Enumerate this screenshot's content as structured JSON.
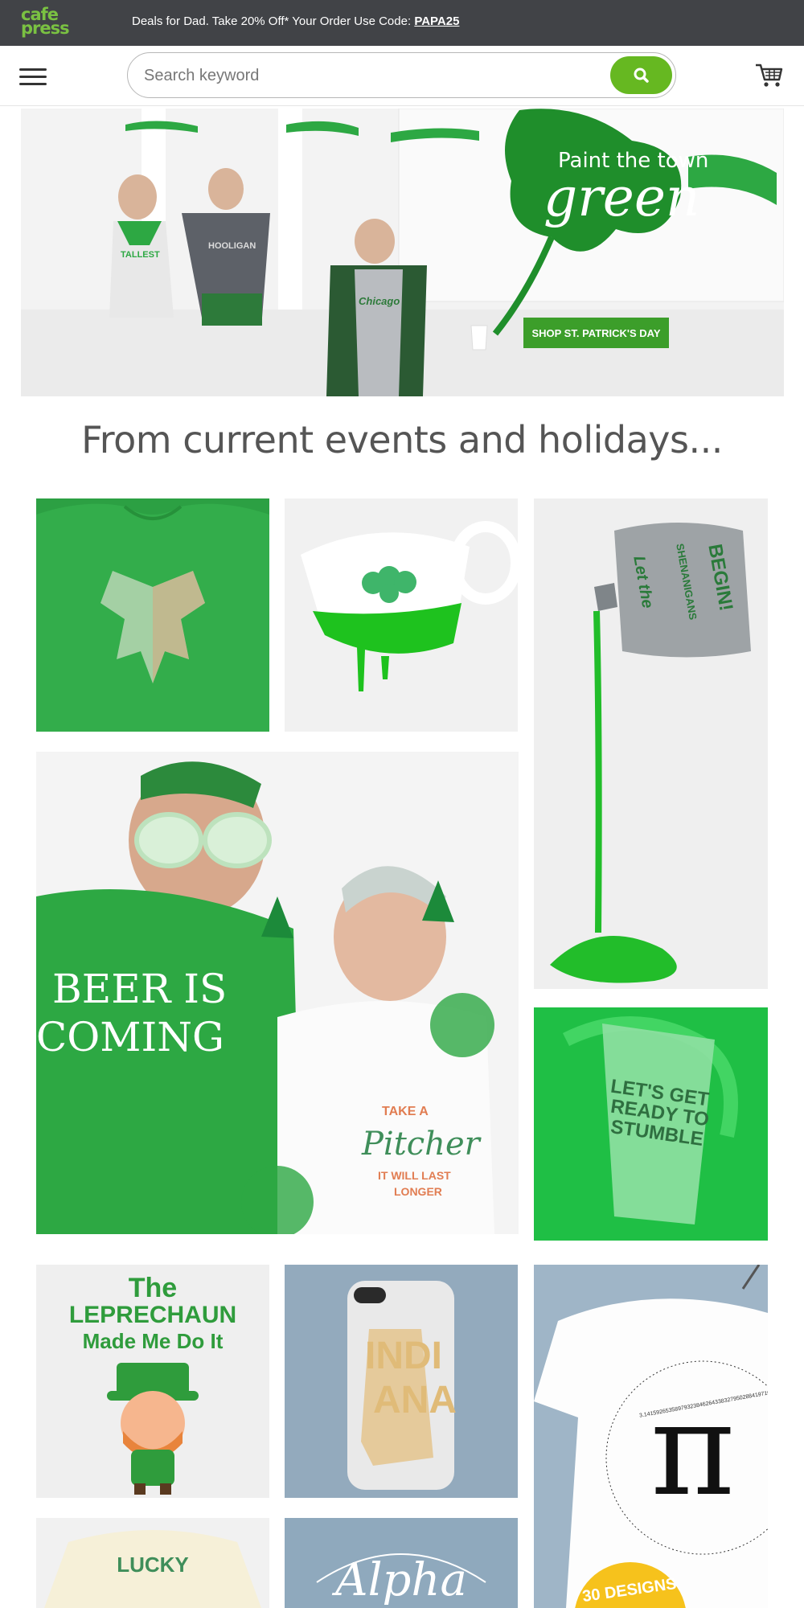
{
  "topbar": {
    "logo_line1": "cafe",
    "logo_line2": "press",
    "promo_text": "Deals for Dad. Take 20% Off* Your Order Use Code: ",
    "promo_code": "PAPA25"
  },
  "header": {
    "search_placeholder": "Search keyword"
  },
  "hero": {
    "tagline": "Paint the town",
    "headline": "green",
    "cta_label": "SHOP ST. PATRICK'S DAY",
    "shirt_tall": "TALLEST",
    "shirt_hooligan": "HOOLIGAN",
    "shirt_chicago": "Chicago"
  },
  "section": {
    "title": "From current events and holidays..."
  },
  "tiles": {
    "flask_line1": "Let the",
    "flask_line2": "SHENANIGANS",
    "flask_line3": "BEGIN!",
    "shirt_beer_line1": "BEER IS",
    "shirt_beer_line2": "COMING",
    "shirt_pitcher_line1": "TAKE A",
    "shirt_pitcher_line2": "Pitcher",
    "shirt_pitcher_line3": "IT WILL LAST",
    "shirt_pitcher_line4": "LONGER",
    "cup_line1": "LET'S GET",
    "cup_line2": "READY TO",
    "cup_line3": "STUMBLE",
    "lep_line1": "The",
    "lep_line2": "LEPRECHAUN",
    "lep_line3": "Made Me Do It",
    "phone_line1": "INDI",
    "phone_line2": "ANA",
    "pi_symbol": "π",
    "pi_digits": "3.14159265358979323846264338327950288419716939937510",
    "badge_text": "30 DESIGNS",
    "onesie_text": "LUCKY",
    "alpha_text": "Alpha"
  },
  "colors": {
    "topbar": "#414347",
    "brand_green": "#7ac142",
    "search_green": "#66b821",
    "cta_green": "#3c9e2a",
    "shirt_green": "#2da843",
    "badge_yellow": "#f6c21c"
  }
}
